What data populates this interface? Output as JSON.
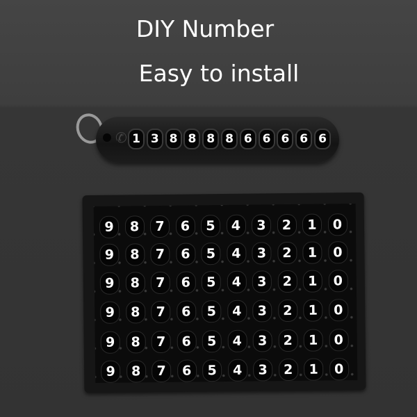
{
  "headline": {
    "line1": "DIY Number",
    "line2": "Easy to install"
  },
  "keychain": {
    "icon": "phone-icon",
    "digits": [
      "1",
      "3",
      "8",
      "8",
      "8",
      "8",
      "6",
      "6",
      "6",
      "6",
      "6"
    ]
  },
  "sticker_sheet": {
    "rows": [
      [
        "9",
        "8",
        "7",
        "6",
        "5",
        "4",
        "3",
        "2",
        "1",
        "0"
      ],
      [
        "9",
        "8",
        "7",
        "6",
        "5",
        "4",
        "3",
        "2",
        "1",
        "0"
      ],
      [
        "9",
        "8",
        "7",
        "6",
        "5",
        "4",
        "3",
        "2",
        "1",
        "0"
      ],
      [
        "9",
        "8",
        "7",
        "6",
        "5",
        "4",
        "3",
        "2",
        "1",
        "0"
      ],
      [
        "9",
        "8",
        "7",
        "6",
        "5",
        "4",
        "3",
        "2",
        "1",
        "0"
      ],
      [
        "9",
        "8",
        "7",
        "6",
        "5",
        "4",
        "3",
        "2",
        "1",
        "0"
      ]
    ]
  }
}
